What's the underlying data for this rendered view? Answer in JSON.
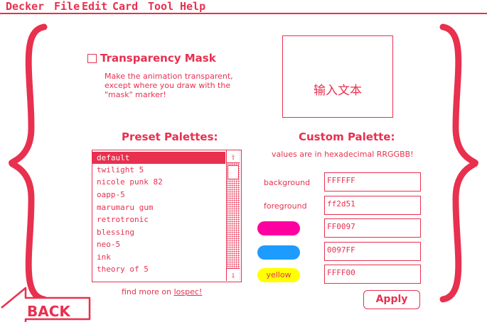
{
  "menubar": {
    "items": [
      "Decker",
      "File",
      "Edit",
      "Card",
      "Tool",
      "Help"
    ]
  },
  "transparency": {
    "label": "Transparency Mask",
    "checked": false,
    "description": [
      "Make the animation transparent,",
      "except where you draw with the",
      "\"mask\" marker!"
    ]
  },
  "text_widget": {
    "text": "输入文本"
  },
  "presets": {
    "heading": "Preset Palettes:",
    "items": [
      "default",
      "twilight 5",
      "nicole punk 82",
      "oapp-5",
      "marumaru gum",
      "retrotronic",
      "blessing",
      "neo-5",
      "ink",
      "theory of 5"
    ],
    "selected": "default",
    "footer_prefix": "find more on ",
    "footer_link": "lospec!"
  },
  "custom": {
    "heading": "Custom Palette:",
    "note": "values are in hexadecimal RRGGBB!",
    "rows": [
      {
        "label": "background",
        "value": "FFFFFF"
      },
      {
        "label": "foreground",
        "value": "ff2d51"
      },
      {
        "label": "",
        "value": "FF0097",
        "swatch": "#ff00a0"
      },
      {
        "label": "",
        "value": "0097FF",
        "swatch": "#1e9bff"
      },
      {
        "label": "yellow",
        "value": "FFFF00",
        "swatch": "#ffff00"
      }
    ]
  },
  "apply_label": "Apply",
  "back_label": "BACK",
  "colors": {
    "accent": "#e8304f",
    "background": "#ffffff"
  }
}
